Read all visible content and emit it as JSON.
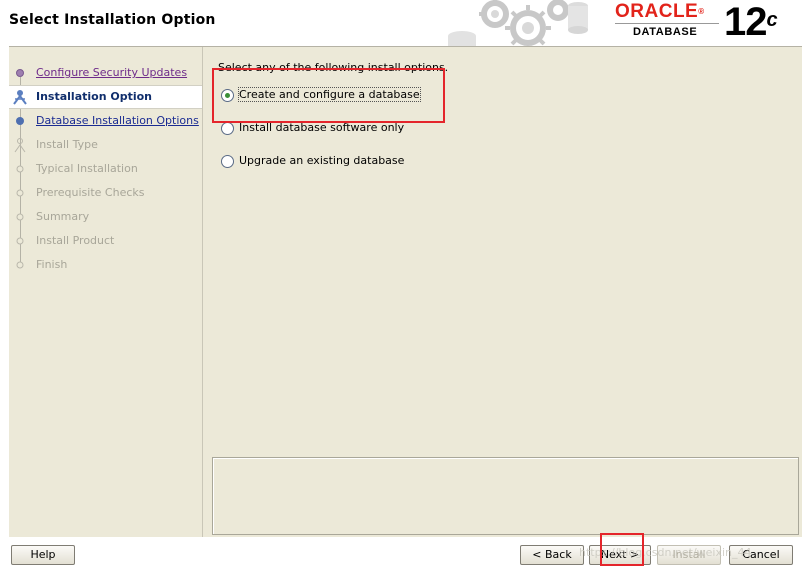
{
  "window": {
    "title": "Select Installation Option"
  },
  "brand": {
    "word": "ORACLE",
    "registered": "®",
    "product": "DATABASE",
    "version_number": "12",
    "version_suffix": "c",
    "color": "#e2231a"
  },
  "steps": [
    {
      "label": "Configure Security Updates",
      "state": "visited"
    },
    {
      "label": "Installation Option",
      "state": "current"
    },
    {
      "label": "Database Installation Options",
      "state": "link"
    },
    {
      "label": "Install Type",
      "state": "disabled"
    },
    {
      "label": "Typical Installation",
      "state": "disabled"
    },
    {
      "label": "Prerequisite Checks",
      "state": "disabled"
    },
    {
      "label": "Summary",
      "state": "disabled"
    },
    {
      "label": "Install Product",
      "state": "disabled"
    },
    {
      "label": "Finish",
      "state": "disabled"
    }
  ],
  "main": {
    "intro": "Select any of the following install options.",
    "options": [
      {
        "label": "Create and configure a database",
        "selected": true
      },
      {
        "label": "Install database software only",
        "selected": false
      },
      {
        "label": "Upgrade an existing database",
        "selected": false
      }
    ]
  },
  "buttons": {
    "help": "Help",
    "back": "< Back",
    "next": "Next >",
    "install": "Install",
    "cancel": "Cancel"
  },
  "watermark": "https://blog.csdn.net/weixin_44",
  "colors": {
    "highlight": "#e4252b",
    "panel": "#ece9d8",
    "link": "#1b2c92",
    "visited": "#6e2b8a"
  }
}
